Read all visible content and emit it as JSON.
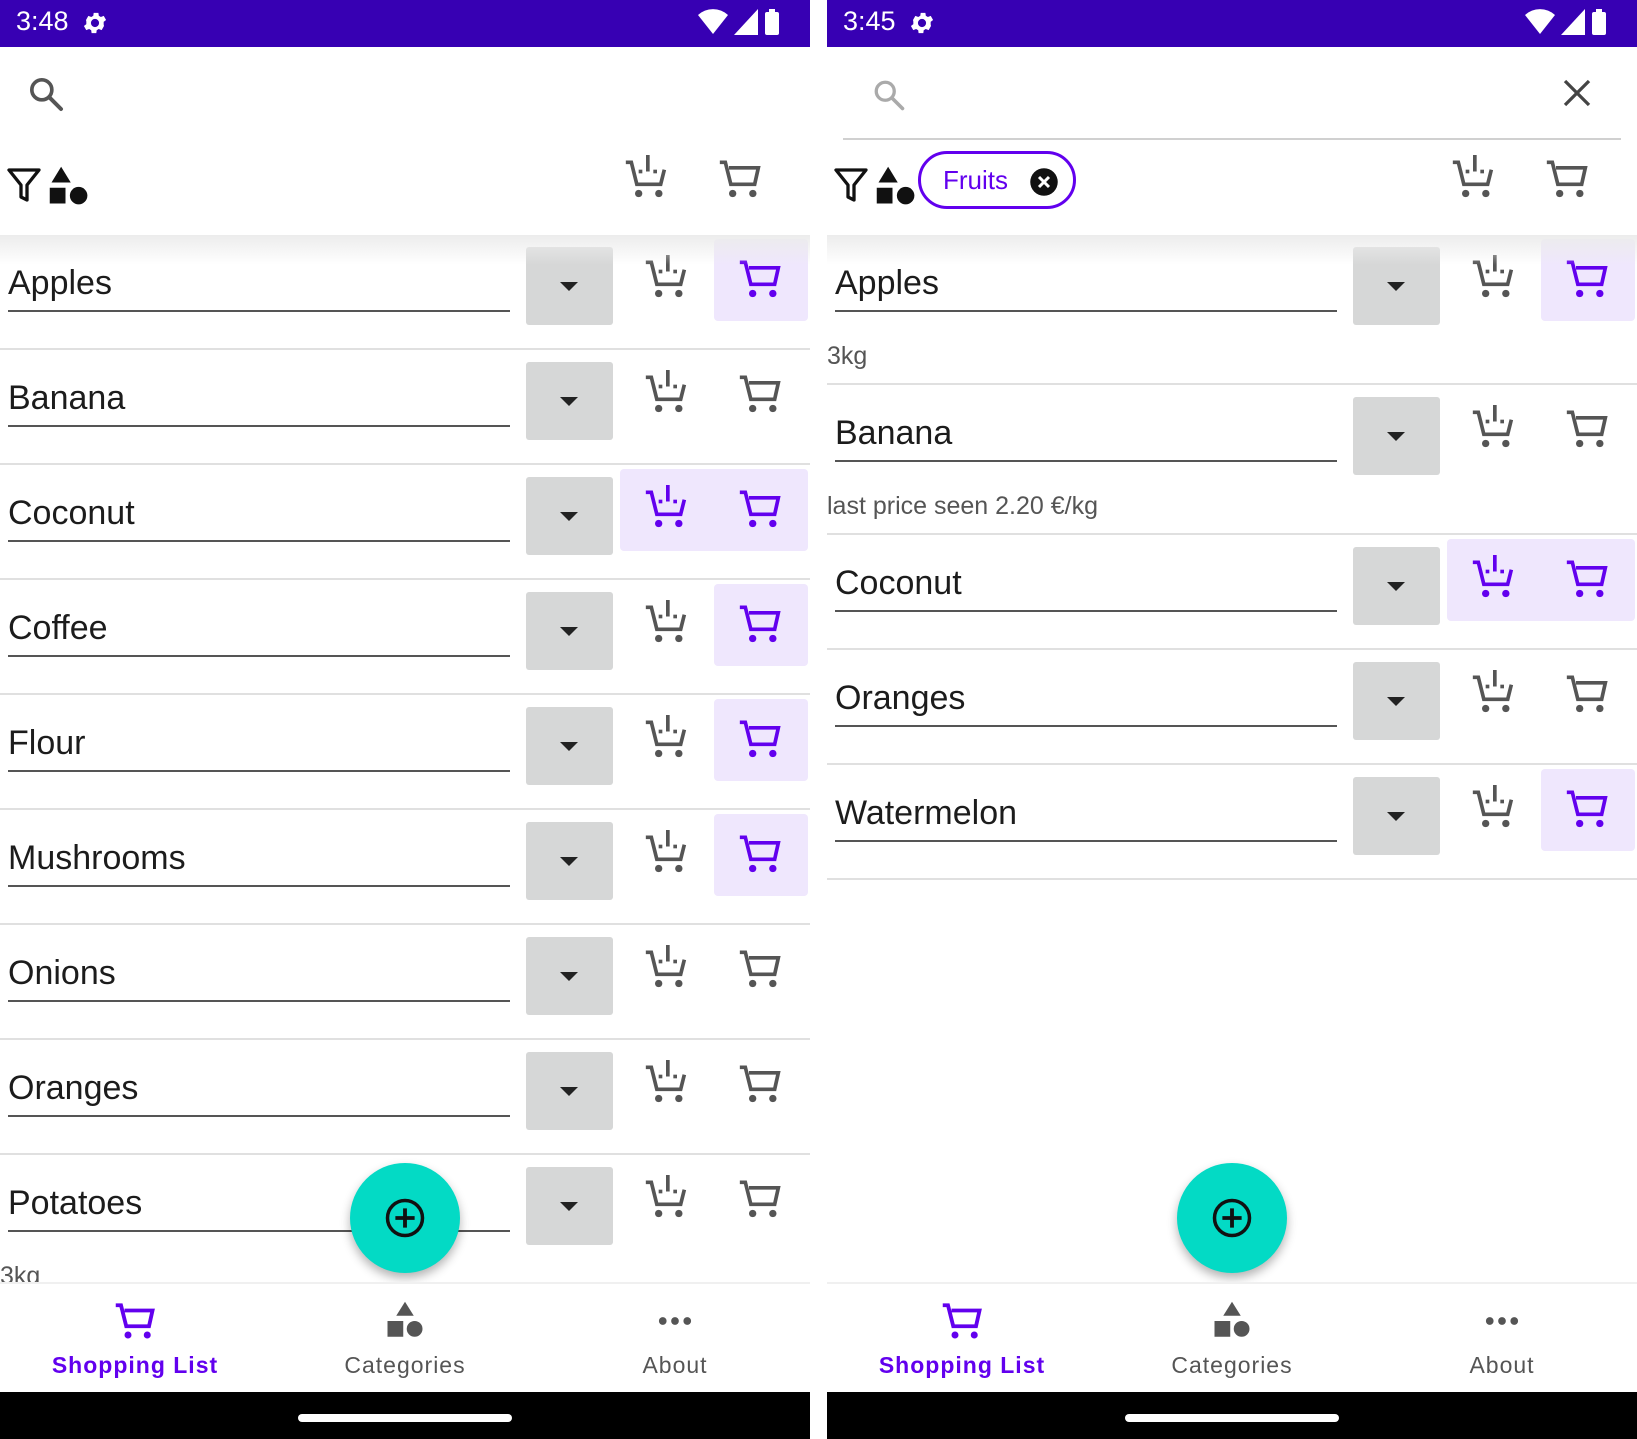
{
  "colors": {
    "accent": "#6200ee",
    "status_bar": "#3700b3",
    "fab": "#03dac5",
    "highlight": "#efe7fd",
    "dropdown_bg": "#d6d7d7"
  },
  "screens": [
    {
      "status": {
        "time": "3:48"
      },
      "search": {
        "active": false
      },
      "filter_chip": null,
      "items": [
        {
          "name": "Apples",
          "note": "",
          "add_active": false,
          "cart_active": true
        },
        {
          "name": "Banana",
          "note": "",
          "add_active": false,
          "cart_active": false
        },
        {
          "name": "Coconut",
          "note": "",
          "add_active": true,
          "cart_active": true
        },
        {
          "name": "Coffee",
          "note": "",
          "add_active": false,
          "cart_active": true
        },
        {
          "name": "Flour",
          "note": "",
          "add_active": false,
          "cart_active": true
        },
        {
          "name": "Mushrooms",
          "note": "",
          "add_active": false,
          "cart_active": true
        },
        {
          "name": "Onions",
          "note": "",
          "add_active": false,
          "cart_active": false
        },
        {
          "name": "Oranges",
          "note": "",
          "add_active": false,
          "cart_active": false
        },
        {
          "name": "Potatoes",
          "note": "3kg",
          "add_active": false,
          "cart_active": false
        }
      ],
      "nav": [
        {
          "label": "Shopping List",
          "icon": "cart-icon",
          "active": true
        },
        {
          "label": "Categories",
          "icon": "categories-icon",
          "active": false
        },
        {
          "label": "About",
          "icon": "more-icon",
          "active": false
        }
      ]
    },
    {
      "status": {
        "time": "3:45"
      },
      "search": {
        "active": true
      },
      "filter_chip": {
        "label": "Fruits"
      },
      "items": [
        {
          "name": "Apples",
          "note": "3kg",
          "add_active": false,
          "cart_active": true
        },
        {
          "name": "Banana",
          "note": "last price seen 2.20 €/kg",
          "add_active": false,
          "cart_active": false
        },
        {
          "name": "Coconut",
          "note": "",
          "add_active": true,
          "cart_active": true
        },
        {
          "name": "Oranges",
          "note": "",
          "add_active": false,
          "cart_active": false
        },
        {
          "name": "Watermelon",
          "note": "",
          "add_active": false,
          "cart_active": true
        }
      ],
      "nav": [
        {
          "label": "Shopping List",
          "icon": "cart-icon",
          "active": true
        },
        {
          "label": "Categories",
          "icon": "categories-icon",
          "active": false
        },
        {
          "label": "About",
          "icon": "more-icon",
          "active": false
        }
      ]
    }
  ]
}
